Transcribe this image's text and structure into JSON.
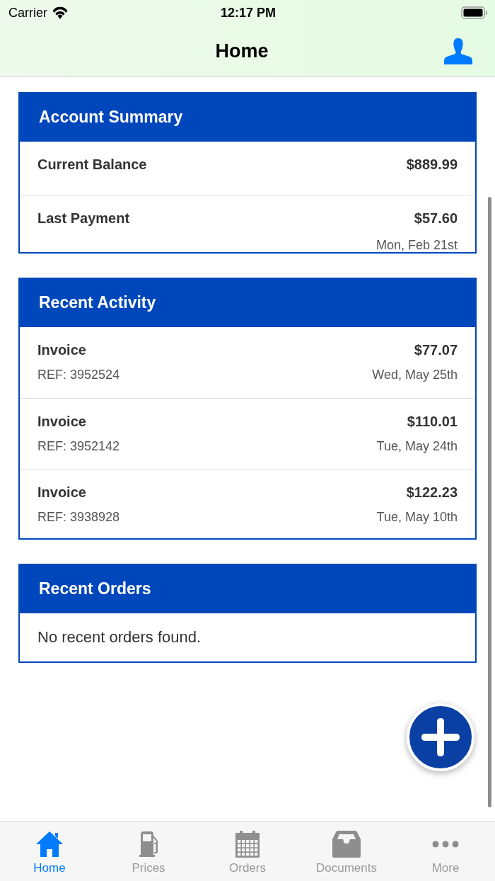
{
  "status_bar": {
    "carrier": "Carrier",
    "time": "12:17 PM"
  },
  "nav_bar": {
    "title": "Home"
  },
  "account_summary": {
    "title": "Account Summary",
    "rows": [
      {
        "label": "Current Balance",
        "amount": "$889.99"
      },
      {
        "label": "Last Payment",
        "amount": "$57.60",
        "date": "Mon, Feb 21st"
      }
    ]
  },
  "recent_activity": {
    "title": "Recent Activity",
    "items": [
      {
        "title": "Invoice",
        "ref": "REF: 3952524",
        "amount": "$77.07",
        "date": "Wed, May 25th"
      },
      {
        "title": "Invoice",
        "ref": "REF: 3952142",
        "amount": "$110.01",
        "date": "Tue, May 24th"
      },
      {
        "title": "Invoice",
        "ref": "REF: 3938928",
        "amount": "$122.23",
        "date": "Tue, May 10th"
      }
    ]
  },
  "recent_orders": {
    "title": "Recent Orders",
    "empty_message": "No recent orders found."
  },
  "tab_bar": {
    "tabs": [
      {
        "label": "Home",
        "selected": true
      },
      {
        "label": "Prices",
        "selected": false
      },
      {
        "label": "Orders",
        "selected": false
      },
      {
        "label": "Documents",
        "selected": false
      },
      {
        "label": "More",
        "selected": false
      }
    ]
  }
}
